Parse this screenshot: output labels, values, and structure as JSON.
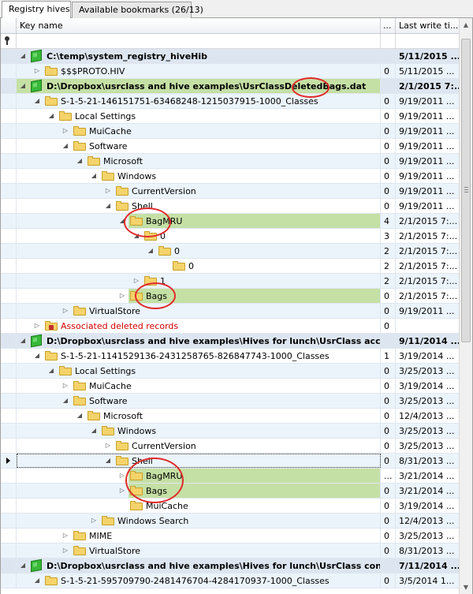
{
  "tabs": [
    {
      "label": "Registry hives",
      "active": true
    },
    {
      "label": "Available bookmarks (26/13)",
      "active": false
    }
  ],
  "columns": {
    "key_name": "Key name",
    "values": "...",
    "last_write": "Last write ti..."
  },
  "rows": [
    {
      "type": "hive",
      "indent": 0,
      "expand": "open",
      "label": "C:\\temp\\system_registry_hiveHib",
      "value": "",
      "date": "5/11/2015 ..."
    },
    {
      "type": "folder",
      "indent": 1,
      "expand": "closed",
      "label": "$$$PROTO.HIV",
      "value": "0",
      "date": "5/11/2015 ..."
    },
    {
      "type": "hive",
      "indent": 0,
      "expand": "open",
      "label": "D:\\Dropbox\\usrclass and hive examples\\UsrClassDeletedBags.dat",
      "value": "",
      "date": "2/1/2015 7:...",
      "highlight": true
    },
    {
      "type": "folder",
      "indent": 1,
      "expand": "open",
      "label": "S-1-5-21-146151751-63468248-1215037915-1000_Classes",
      "value": "0",
      "date": "9/19/2011 ..."
    },
    {
      "type": "folder",
      "indent": 2,
      "expand": "open",
      "label": "Local Settings",
      "value": "0",
      "date": "9/19/2011 ..."
    },
    {
      "type": "folder",
      "indent": 3,
      "expand": "closed",
      "label": "MuiCache",
      "value": "0",
      "date": "9/19/2011 ..."
    },
    {
      "type": "folder",
      "indent": 3,
      "expand": "open",
      "label": "Software",
      "value": "0",
      "date": "9/19/2011 ..."
    },
    {
      "type": "folder",
      "indent": 4,
      "expand": "open",
      "label": "Microsoft",
      "value": "0",
      "date": "9/19/2011 ..."
    },
    {
      "type": "folder",
      "indent": 5,
      "expand": "open",
      "label": "Windows",
      "value": "0",
      "date": "9/19/2011 ..."
    },
    {
      "type": "folder",
      "indent": 6,
      "expand": "closed",
      "label": "CurrentVersion",
      "value": "0",
      "date": "9/19/2011 ..."
    },
    {
      "type": "folder",
      "indent": 6,
      "expand": "open",
      "label": "Shell",
      "value": "0",
      "date": "9/19/2011 ..."
    },
    {
      "type": "folder",
      "indent": 7,
      "expand": "open",
      "label": "BagMRU",
      "value": "4",
      "date": "2/1/2015 7:...",
      "highlight": true
    },
    {
      "type": "folder",
      "indent": 8,
      "expand": "open",
      "label": "0",
      "value": "3",
      "date": "2/1/2015 7:..."
    },
    {
      "type": "folder",
      "indent": 9,
      "expand": "open",
      "label": "0",
      "value": "2",
      "date": "2/1/2015 7:..."
    },
    {
      "type": "folder",
      "indent": 10,
      "expand": "none",
      "label": "0",
      "value": "2",
      "date": "2/1/2015 7:..."
    },
    {
      "type": "folder",
      "indent": 8,
      "expand": "closed",
      "label": "1",
      "value": "2",
      "date": "2/1/2015 7:..."
    },
    {
      "type": "folder",
      "indent": 7,
      "expand": "closed",
      "label": "Bags",
      "value": "0",
      "date": "2/1/2015 7:...",
      "highlight": true
    },
    {
      "type": "folder",
      "indent": 3,
      "expand": "closed",
      "label": "VirtualStore",
      "value": "0",
      "date": "9/19/2011 ..."
    },
    {
      "type": "locked",
      "indent": 1,
      "expand": "closed",
      "label": "Associated deleted records",
      "value": "0",
      "date": "",
      "red": true
    },
    {
      "type": "hive",
      "indent": 0,
      "expand": "open",
      "label": "D:\\Dropbox\\usrclass and hive examples\\Hives for lunch\\UsrClass accoun...",
      "value": "",
      "date": "9/11/2014 ..."
    },
    {
      "type": "folder",
      "indent": 1,
      "expand": "open",
      "label": "S-1-5-21-1141529136-2431258765-826847743-1000_Classes",
      "value": "1",
      "date": "3/19/2014 ..."
    },
    {
      "type": "folder",
      "indent": 2,
      "expand": "open",
      "label": "Local Settings",
      "value": "0",
      "date": "3/25/2013 ..."
    },
    {
      "type": "folder",
      "indent": 3,
      "expand": "closed",
      "label": "MuiCache",
      "value": "0",
      "date": "3/19/2014 ..."
    },
    {
      "type": "folder",
      "indent": 3,
      "expand": "open",
      "label": "Software",
      "value": "0",
      "date": "3/25/2013 ..."
    },
    {
      "type": "folder",
      "indent": 4,
      "expand": "open",
      "label": "Microsoft",
      "value": "0",
      "date": "12/4/2013 ..."
    },
    {
      "type": "folder",
      "indent": 5,
      "expand": "open",
      "label": "Windows",
      "value": "0",
      "date": "3/25/2013 ..."
    },
    {
      "type": "folder",
      "indent": 6,
      "expand": "closed",
      "label": "CurrentVersion",
      "value": "0",
      "date": "3/25/2013 ..."
    },
    {
      "type": "folder",
      "indent": 6,
      "expand": "open",
      "label": "Shell",
      "value": "0",
      "date": "8/31/2013 ...",
      "selected": true
    },
    {
      "type": "folder",
      "indent": 7,
      "expand": "closed",
      "label": "BagMRU",
      "value": "...",
      "date": "3/21/2014 ...",
      "highlight": true
    },
    {
      "type": "folder",
      "indent": 7,
      "expand": "closed",
      "label": "Bags",
      "value": "0",
      "date": "3/21/2014 ...",
      "highlight": true
    },
    {
      "type": "folder",
      "indent": 7,
      "expand": "none",
      "label": "MuiCache",
      "value": "0",
      "date": "3/19/2014 ..."
    },
    {
      "type": "folder",
      "indent": 5,
      "expand": "closed",
      "label": "Windows Search",
      "value": "0",
      "date": "12/4/2013 ..."
    },
    {
      "type": "folder",
      "indent": 3,
      "expand": "closed",
      "label": "MIME",
      "value": "0",
      "date": "3/25/2013 ..."
    },
    {
      "type": "folder",
      "indent": 3,
      "expand": "closed",
      "label": "VirtualStore",
      "value": "0",
      "date": "8/31/2013 ..."
    },
    {
      "type": "hive",
      "indent": 0,
      "expand": "open",
      "label": "D:\\Dropbox\\usrclass and hive examples\\Hives for lunch\\UsrClass control...",
      "value": "",
      "date": "7/11/2014 ..."
    },
    {
      "type": "folder",
      "indent": 1,
      "expand": "open",
      "label": "S-1-5-21-595709790-2481476704-4284170937-1000_Classes",
      "value": "0",
      "date": "3/5/2014 1..."
    }
  ],
  "colors": {
    "highlight": "#c5e0a5",
    "hive_row": "#dde6f0",
    "alt_row": "#ebf4fb",
    "deleted_text": "#d40000",
    "annotation_circle": "#e02a2a"
  }
}
